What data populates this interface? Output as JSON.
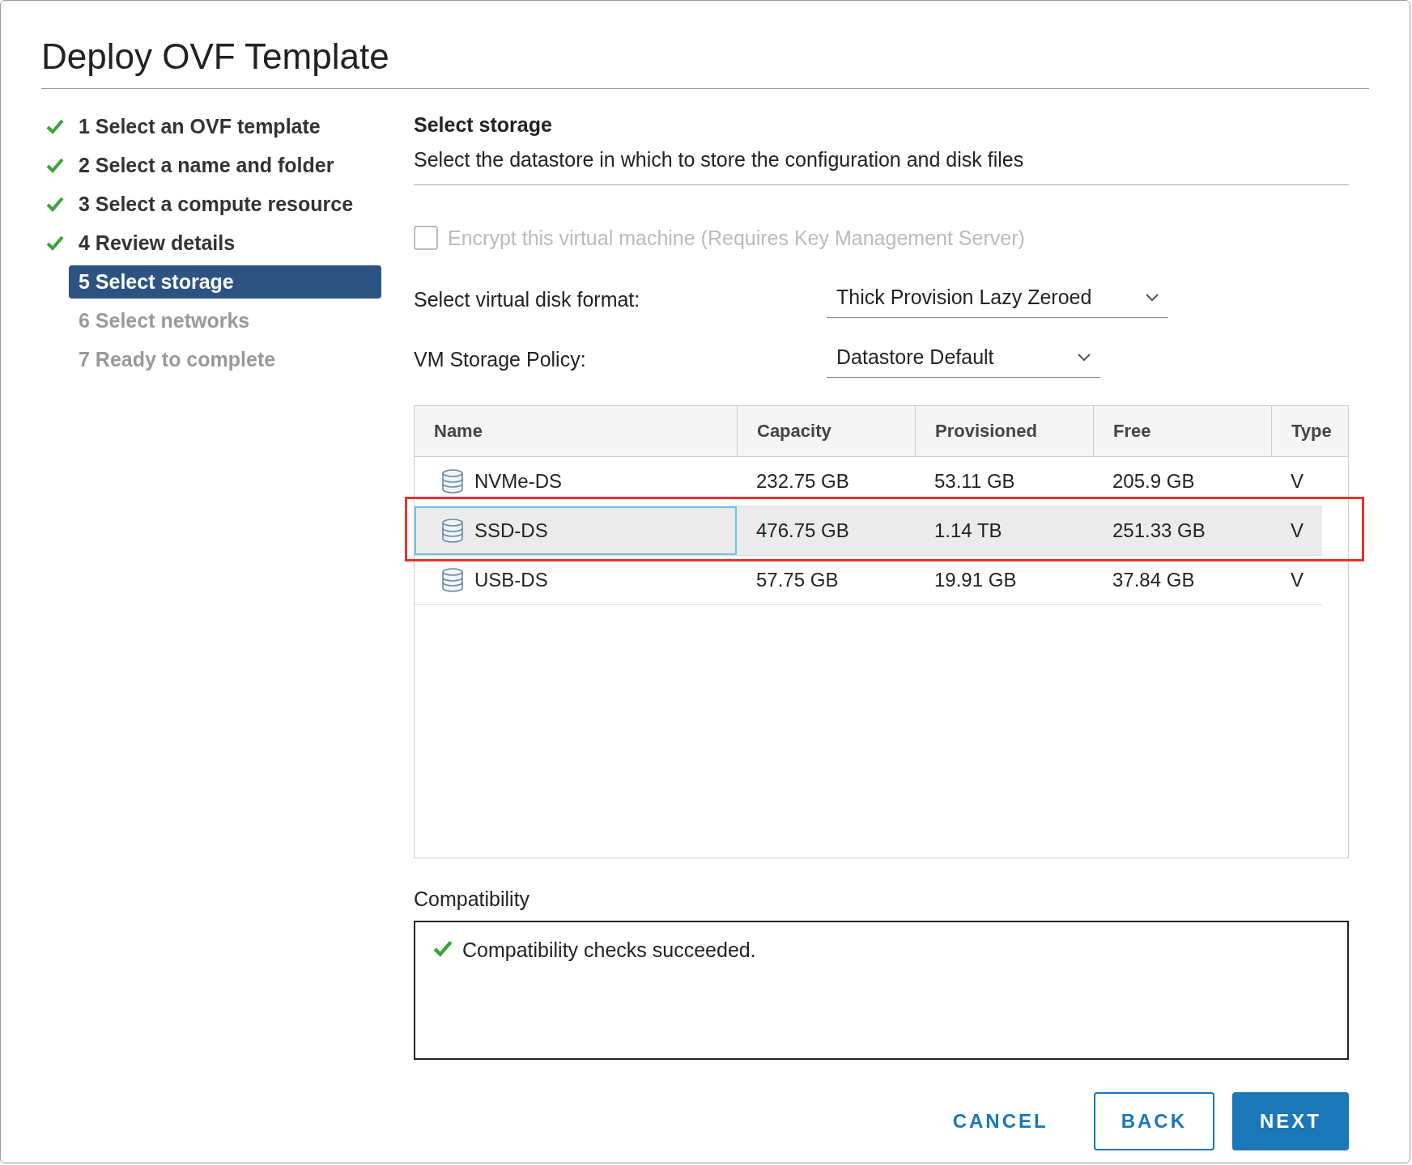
{
  "window": {
    "title": "Deploy OVF Template"
  },
  "steps": [
    {
      "label": "1 Select an OVF template",
      "completed": true,
      "disabled": false,
      "selected": false
    },
    {
      "label": "2 Select a name and folder",
      "completed": true,
      "disabled": false,
      "selected": false
    },
    {
      "label": "3 Select a compute resource",
      "completed": true,
      "disabled": false,
      "selected": false
    },
    {
      "label": "4 Review details",
      "completed": true,
      "disabled": false,
      "selected": false
    },
    {
      "label": "5 Select storage",
      "completed": false,
      "disabled": false,
      "selected": true
    },
    {
      "label": "6 Select networks",
      "completed": false,
      "disabled": true,
      "selected": false
    },
    {
      "label": "7 Ready to complete",
      "completed": false,
      "disabled": true,
      "selected": false
    }
  ],
  "page": {
    "title": "Select storage",
    "subtitle": "Select the datastore in which to store the configuration and disk files"
  },
  "encrypt": {
    "label": "Encrypt this virtual machine (Requires Key Management Server)",
    "checked": false,
    "disabled": true
  },
  "disk_format": {
    "label": "Select virtual disk format:",
    "value": "Thick Provision Lazy Zeroed"
  },
  "storage_policy": {
    "label": "VM Storage Policy:",
    "value": "Datastore Default"
  },
  "table": {
    "columns": [
      "Name",
      "Capacity",
      "Provisioned",
      "Free",
      "Type"
    ],
    "rows": [
      {
        "cells": [
          "NVMe-DS",
          "232.75 GB",
          "53.11 GB",
          "205.9 GB",
          "V"
        ],
        "selected": false,
        "highlighted": false
      },
      {
        "cells": [
          "SSD-DS",
          "476.75 GB",
          "1.14 TB",
          "251.33 GB",
          "V"
        ],
        "selected": true,
        "highlighted": true
      },
      {
        "cells": [
          "USB-DS",
          "57.75 GB",
          "19.91 GB",
          "37.84 GB",
          "V"
        ],
        "selected": false,
        "highlighted": false
      }
    ]
  },
  "compatibility": {
    "label": "Compatibility",
    "message": "Compatibility checks succeeded.",
    "ok": true
  },
  "buttons": [
    {
      "label": "CANCEL",
      "kind": "flat"
    },
    {
      "label": "BACK",
      "kind": "outline"
    },
    {
      "label": "NEXT",
      "kind": "primary"
    }
  ]
}
